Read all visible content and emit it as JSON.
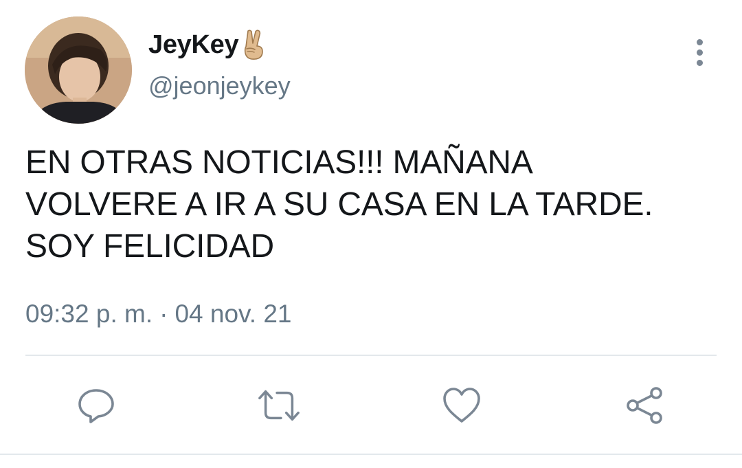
{
  "tweet": {
    "author": {
      "display_name": "JeyKey",
      "handle": "@jeonjeykey",
      "badge_icon": "victory-hand-icon",
      "avatar_icon": "avatar-photo"
    },
    "text_lines": [
      "EN OTRAS NOTICIAS!!! MAÑANA",
      "VOLVERE A IR A SU CASA EN LA TARDE.",
      "SOY FELICIDAD"
    ],
    "time": "09:32 p. m.",
    "separator": "·",
    "date": "04 nov. 21"
  },
  "actions": [
    {
      "name": "reply",
      "icon": "reply-icon"
    },
    {
      "name": "retweet",
      "icon": "retweet-icon"
    },
    {
      "name": "like",
      "icon": "heart-icon"
    },
    {
      "name": "share",
      "icon": "share-icon"
    }
  ],
  "menu": {
    "icon": "more-options-icon"
  },
  "colors": {
    "text_primary": "#14171a",
    "text_secondary": "#657786",
    "icon_gray": "#7b8794",
    "divider": "#e3e8ec"
  }
}
